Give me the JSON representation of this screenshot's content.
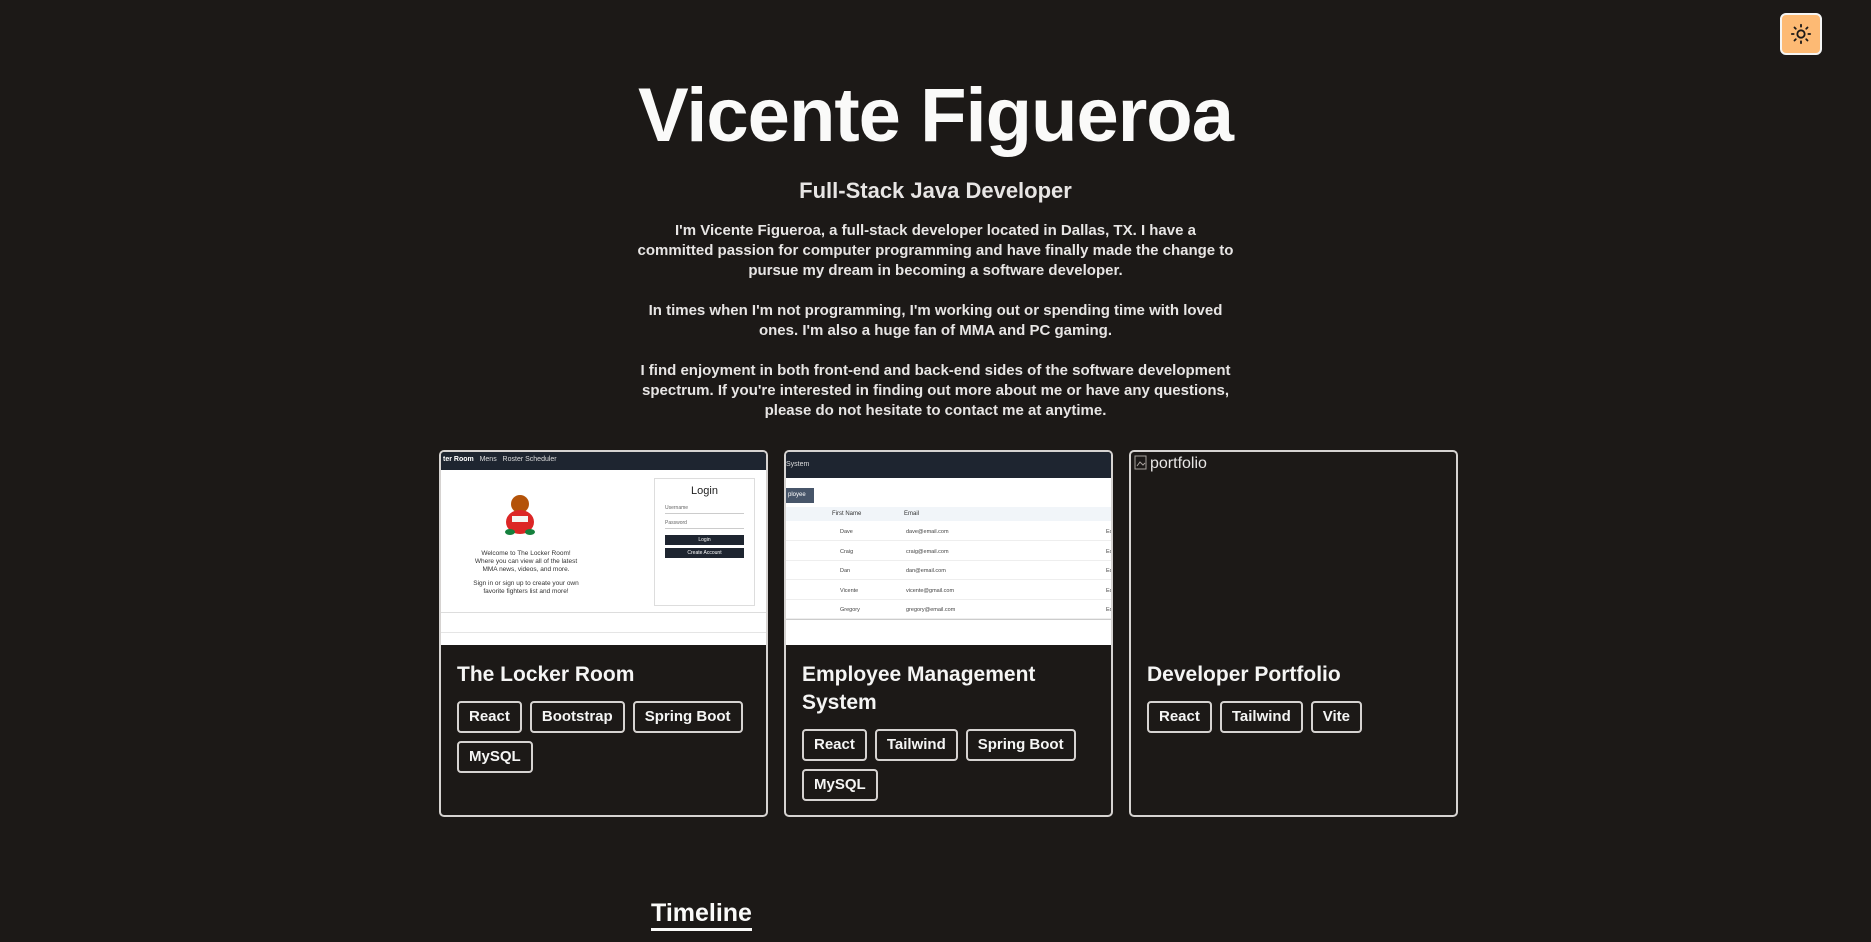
{
  "hero": {
    "name": "Vicente Figueroa",
    "role": "Full-Stack Java Developer",
    "bio": [
      "I'm Vicente Figueroa, a full-stack developer located in Dallas, TX. I have a committed passion for computer programming and have finally made the change to pursue my dream in becoming a software developer.",
      "In times when I'm not programming, I'm working out or spending time with loved ones. I'm also a huge fan of MMA and PC gaming.",
      "I find enjoyment in both front-end and back-end sides of the software development spectrum. If you're interested in finding out more about me or have any questions, please do not hesitate to contact me at anytime."
    ]
  },
  "theme_toggle": {
    "icon": "sun-icon",
    "color": "#fdba74"
  },
  "projects": [
    {
      "title": "The Locker Room",
      "tags": [
        "React",
        "Bootstrap",
        "Spring Boot",
        "MySQL"
      ],
      "thumb": {
        "nav": [
          "ter Room",
          "Mens",
          "Roster Scheduler"
        ],
        "login_title": "Login",
        "username": "Username",
        "password": "Password",
        "login_btn": "Login",
        "create_btn": "Create Account",
        "welcome": "Welcome to The Locker Room!",
        "line1": "Where you can view all of the latest",
        "line2": "MMA news, videos, and more.",
        "line3": "Sign in or sign up to create your own",
        "line4": "favorite fighters list and more!"
      }
    },
    {
      "title": "Employee Management System",
      "tags": [
        "React",
        "Tailwind",
        "Spring Boot",
        "MySQL"
      ],
      "thumb": {
        "header": "System",
        "add_btn": "ployee",
        "columns": [
          "First Name",
          "Email"
        ],
        "rows": [
          {
            "name": "Dave",
            "email": "dave@email.com"
          },
          {
            "name": "Craig",
            "email": "craig@email.com"
          },
          {
            "name": "Dan",
            "email": "dan@email.com"
          },
          {
            "name": "Vicente",
            "email": "vicente@gmail.com"
          },
          {
            "name": "Gregory",
            "email": "gregory@email.com"
          }
        ],
        "action": "Edit"
      }
    },
    {
      "title": "Developer Portfolio",
      "tags": [
        "React",
        "Tailwind",
        "Vite"
      ],
      "thumb": {
        "alt": "portfolio"
      }
    }
  ],
  "timeline": {
    "heading": "Timeline"
  }
}
